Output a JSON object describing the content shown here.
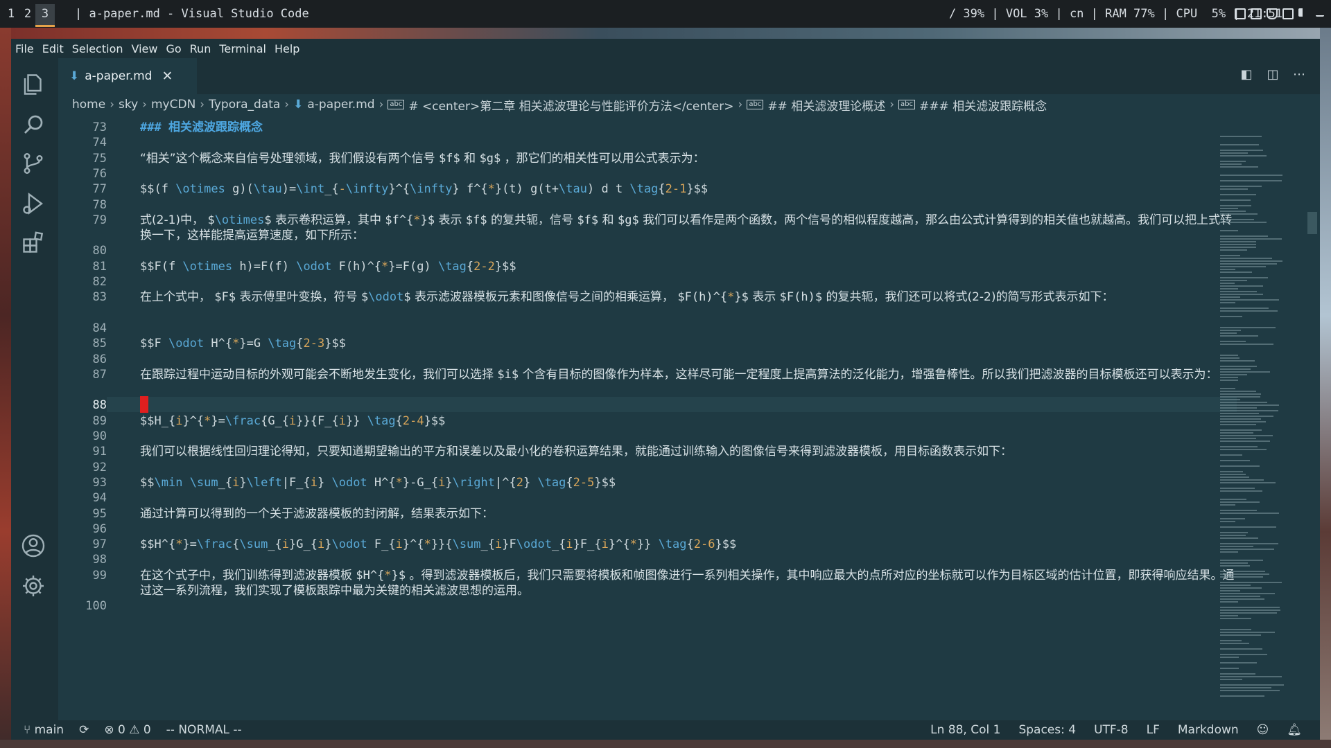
{
  "system_bar": {
    "workspaces": [
      "1",
      "2",
      "3"
    ],
    "active_workspace": "3",
    "window_title": "| a-paper.md - Visual Studio Code",
    "status": "/ 39% | VOL 3% | cn | RAM 77% | CPU  5% | 21:51",
    "tray_icons": [
      "lock-icon",
      "display-icon",
      "shield-icon",
      "clipboard-icon",
      "volume-icon",
      "minimize-icon"
    ]
  },
  "menu": [
    "File",
    "Edit",
    "Selection",
    "View",
    "Go",
    "Run",
    "Terminal",
    "Help"
  ],
  "activity_bar": {
    "top": [
      "explorer-icon",
      "search-icon",
      "source-control-icon",
      "run-debug-icon",
      "extensions-icon"
    ],
    "bottom": [
      "accounts-icon",
      "settings-gear-icon"
    ]
  },
  "tab": {
    "label": "a-paper.md",
    "icon": "markdown-icon",
    "close": "✕"
  },
  "tab_actions": [
    "open-preview-icon",
    "split-editor-icon",
    "more-actions-icon"
  ],
  "breadcrumb": {
    "path": [
      "home",
      "sky",
      "myCDN",
      "Typora_data"
    ],
    "file": "a-paper.md",
    "symbols": [
      "# <center>第二章 相关滤波理论与性能评价方法</center>",
      "## 相关滤波理论概述",
      "### 相关滤波跟踪概念"
    ]
  },
  "editor": {
    "current_line": "88",
    "lines": [
      {
        "n": "73",
        "text": "###  相关滤波跟踪概念"
      },
      {
        "n": "74",
        "text": ""
      },
      {
        "n": "75",
        "text": "“相关”这个概念来自信号处理领域，我们假设有两个信号 $f$ 和 $g$ ，那它们的相关性可以用公式表示为："
      },
      {
        "n": "76",
        "text": ""
      },
      {
        "n": "77",
        "text": "$$(f \\otimes g)(\\tau)=\\int_{-\\infty}^{\\infty} f^{*}(t) g(t+\\tau) d t \\tag{2-1}$$"
      },
      {
        "n": "78",
        "text": ""
      },
      {
        "n": "79",
        "text": "式(2-1)中， $\\otimes$ 表示卷积运算，其中 $f^{*}$ 表示 $f$ 的复共轭，信号 $f$ 和 $g$ 我们可以看作是两个函数，两个信号的相似程度越高，那么由公式计算得到的相关值也就越高。我们可以把上式转换一下，这样能提高运算速度，如下所示："
      },
      {
        "n": "80",
        "text": ""
      },
      {
        "n": "81",
        "text": "$$F(f \\otimes h)=F(f) \\odot F(h)^{*}=F(g) \\tag{2-2}$$"
      },
      {
        "n": "82",
        "text": ""
      },
      {
        "n": "83",
        "text": "在上个式中， $F$ 表示傅里叶变换，符号 $\\odot$ 表示滤波器模板元素和图像信号之间的相乘运算， $F(h)^{*}$ 表示 $F(h)$ 的复共轭，我们还可以将式(2-2)的简写形式表示如下："
      },
      {
        "n": "84",
        "text": ""
      },
      {
        "n": "85",
        "text": "$$F \\odot H^{*}=G \\tag{2-3}$$"
      },
      {
        "n": "86",
        "text": ""
      },
      {
        "n": "87",
        "text": "在跟踪过程中运动目标的外观可能会不断地发生变化，我们可以选择 $i$ 个含有目标的图像作为样本，这样尽可能一定程度上提高算法的泛化能力，增强鲁棒性。所以我们把滤波器的目标模板还可以表示为："
      },
      {
        "n": "88",
        "text": ""
      },
      {
        "n": "89",
        "text": "$$H_{i}^{*}=\\frac{G_{i}}{F_{i}} \\tag{2-4}$$"
      },
      {
        "n": "90",
        "text": ""
      },
      {
        "n": "91",
        "text": "我们可以根据线性回归理论得知，只要知道期望输出的平方和误差以及最小化的卷积运算结果，就能通过训练输入的图像信号来得到滤波器模板，用目标函数表示如下："
      },
      {
        "n": "92",
        "text": ""
      },
      {
        "n": "93",
        "text": "$$\\min \\sum_{i}\\left|F_{i} \\odot H^{*}-G_{i}\\right|^{2} \\tag{2-5}$$"
      },
      {
        "n": "94",
        "text": ""
      },
      {
        "n": "95",
        "text": "通过计算可以得到的一个关于滤波器模板的封闭解，结果表示如下："
      },
      {
        "n": "96",
        "text": ""
      },
      {
        "n": "97",
        "text": "$$H^{*}=\\frac{\\sum_{i}G_{i}\\odot F_{i}^{*}}{\\sum_{i}F\\odot_{i}F_{i}^{*}} \\tag{2-6}$$"
      },
      {
        "n": "98",
        "text": ""
      },
      {
        "n": "99",
        "text": "在这个式子中，我们训练得到滤波器模板 $H^{*}$ 。得到滤波器模板后，我们只需要将模板和帧图像进行一系列相关操作，其中响应最大的点所对应的坐标就可以作为目标区域的估计位置，即获得响应结果。通过这一系列流程，我们实现了模板跟踪中最为关键的相关滤波思想的运用。"
      },
      {
        "n": "100",
        "text": ""
      }
    ]
  },
  "status_bar": {
    "branch": "main",
    "sync": "⟳",
    "problems": "⊗ 0 ⚠ 0",
    "mode": "-- NORMAL --",
    "position": "Ln 88, Col 1",
    "spaces": "Spaces: 4",
    "encoding": "UTF-8",
    "eol": "LF",
    "language": "Markdown"
  }
}
